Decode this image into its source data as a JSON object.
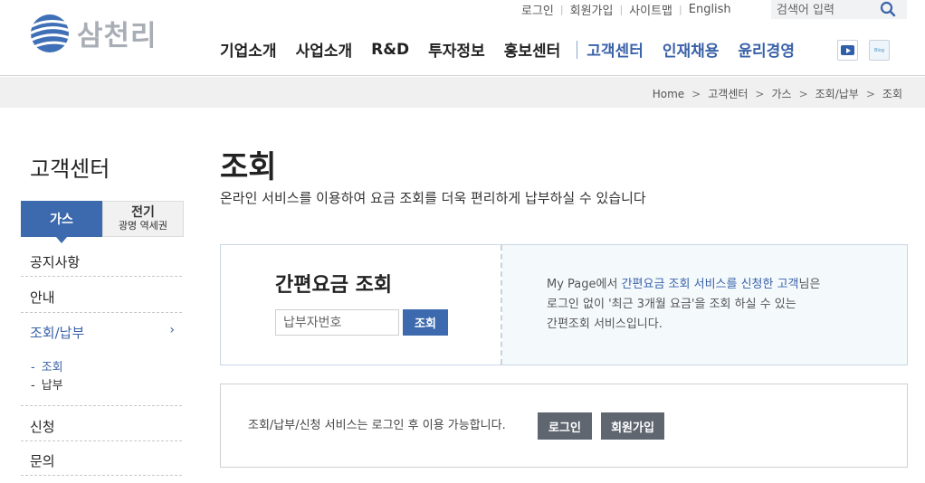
{
  "header": {
    "logo_text": "삼천리",
    "util_links": [
      "로그인",
      "회원가입",
      "사이트맵",
      "English"
    ],
    "search_placeholder": "검색어 입력",
    "gnb_main": [
      "기업소개",
      "사업소개",
      "R&D",
      "투자정보",
      "홍보센터"
    ],
    "gnb_sub": [
      "고객센터",
      "인재채용",
      "윤리경영"
    ],
    "blog_label": "Blog"
  },
  "breadcrumb": [
    "Home",
    "고객센터",
    "가스",
    "조회/납부",
    "조회"
  ],
  "sidebar": {
    "title": "고객센터",
    "tab_gas": "가스",
    "tab_elec_line1": "전기",
    "tab_elec_line2": "광명 역세권",
    "menu": [
      "공지사항",
      "안내",
      "조회/납부",
      "신청",
      "문의"
    ],
    "sub_menu": [
      "조회",
      "납부"
    ]
  },
  "main": {
    "title": "조회",
    "description": "온라인 서비스를 이용하여 요금 조회를 더욱 편리하게 납부하실 수 있습니다",
    "quick": {
      "title": "간편요금 조회",
      "input_placeholder": "납부자번호",
      "button": "조회",
      "info_prefix": "My Page에서 ",
      "info_highlight": "간편요금 조회 서비스를 신청한 고객",
      "info_suffix": "님은",
      "info_line2": "로그인 없이 '최근 3개월 요금'을 조회 하실 수 있는",
      "info_line3": "간편조회 서비스입니다."
    },
    "login_box": {
      "message": "조회/납부/신청 서비스는 로그인 후 이용 가능합니다.",
      "login_button": "로그인",
      "join_button": "회원가입"
    }
  },
  "colors": {
    "primary_blue": "#3d6aaf",
    "link_blue": "#3a62a8",
    "logo_gray": "#a9aeb6",
    "dark_button": "#5f6670"
  }
}
